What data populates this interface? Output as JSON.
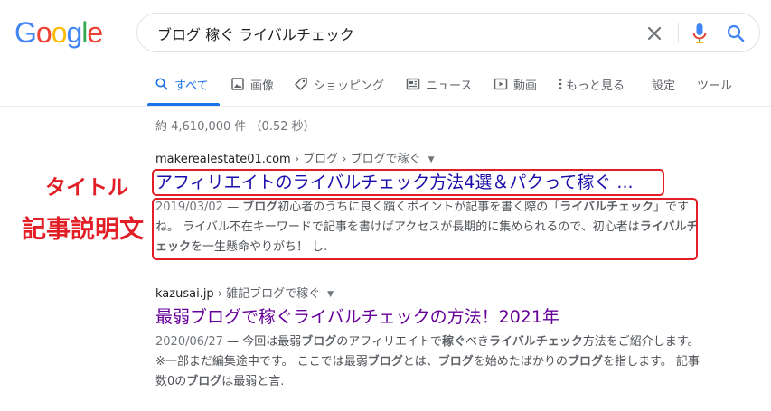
{
  "logo": {
    "letters": [
      "G",
      "o",
      "o",
      "g",
      "l",
      "e"
    ],
    "colors": [
      "#4285f4",
      "#ea4335",
      "#fbbc05",
      "#4285f4",
      "#34a853",
      "#ea4335"
    ]
  },
  "search": {
    "query": "ブログ 稼ぐ ライバルチェック"
  },
  "tabs": [
    {
      "label": "すべて",
      "icon": "search-icon",
      "active": true
    },
    {
      "label": "画像",
      "icon": "image-icon"
    },
    {
      "label": "ショッピング",
      "icon": "tag-icon"
    },
    {
      "label": "ニュース",
      "icon": "news-icon"
    },
    {
      "label": "動画",
      "icon": "play-icon"
    },
    {
      "label": "もっと見る",
      "icon": "more-vert-icon"
    },
    {
      "label": "設定"
    },
    {
      "label": "ツール"
    }
  ],
  "stats": "約 4,610,000 件 （0.52 秒）",
  "results": [
    {
      "domain": "makerealestate01.com",
      "path": " › ブログ › ブログで稼ぐ",
      "title": "アフィリエイトのライバルチェック方法4選＆パクって稼ぐ ...",
      "date": "2019/03/02",
      "snippet": [
        {
          "t": " — ",
          "b": false
        },
        {
          "t": "ブログ",
          "b": true
        },
        {
          "t": "初心者のうちに良く躓くポイントが記事を書く際の「",
          "b": false
        },
        {
          "t": "ライバルチェック",
          "b": true
        },
        {
          "t": "」ですね。 ライバル不在キーワードで記事を書けばアクセスが長期的に集められるので、初心者は",
          "b": false
        },
        {
          "t": "ライバルチェック",
          "b": true
        },
        {
          "t": "を一生懸命やりがち！ し.",
          "b": false
        }
      ]
    },
    {
      "domain": "kazusai.jp",
      "path": " › 雑記ブログで稼ぐ",
      "title": "最弱ブログで稼ぐライバルチェックの方法！2021年",
      "date": "2020/06/27",
      "snippet": [
        {
          "t": " — 今回は最弱",
          "b": false
        },
        {
          "t": "ブログ",
          "b": true
        },
        {
          "t": "のアフィリエイトで",
          "b": false
        },
        {
          "t": "稼ぐ",
          "b": true
        },
        {
          "t": "べき",
          "b": false
        },
        {
          "t": "ライバルチェック",
          "b": true
        },
        {
          "t": "方法をご紹介します。 ※一部まだ編集途中です。 ここでは最弱",
          "b": false
        },
        {
          "t": "ブログ",
          "b": true
        },
        {
          "t": "とは、",
          "b": false
        },
        {
          "t": "ブログ",
          "b": true
        },
        {
          "t": "を始めたばかりの",
          "b": false
        },
        {
          "t": "ブログ",
          "b": true
        },
        {
          "t": "を指します。 記事数0の",
          "b": false
        },
        {
          "t": "ブログ",
          "b": true
        },
        {
          "t": "は最弱と言.",
          "b": false
        }
      ]
    }
  ],
  "annotations": {
    "title_label": "タイトル",
    "description_label": "記事説明文",
    "color": "#e21f26"
  }
}
